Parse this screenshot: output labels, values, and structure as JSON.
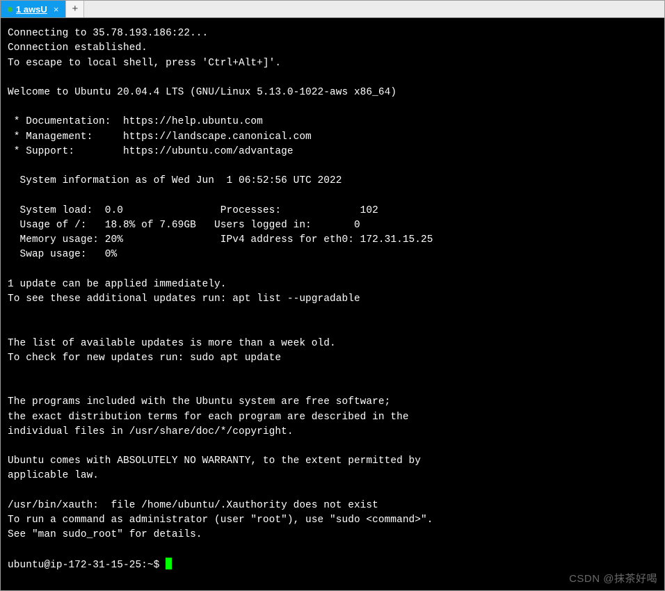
{
  "tabs": {
    "active_label": "1 awsU",
    "close_glyph": "×",
    "new_tab_glyph": "+"
  },
  "terminal": {
    "connecting": "Connecting to 35.78.193.186:22...",
    "established": "Connection established.",
    "escape_hint": "To escape to local shell, press 'Ctrl+Alt+]'.",
    "welcome": "Welcome to Ubuntu 20.04.4 LTS (GNU/Linux 5.13.0-1022-aws x86_64)",
    "doc_line": " * Documentation:  https://help.ubuntu.com",
    "mgmt_line": " * Management:     https://landscape.canonical.com",
    "support_line": " * Support:        https://ubuntu.com/advantage",
    "sysinfo_header": "  System information as of Wed Jun  1 06:52:56 UTC 2022",
    "row1": "  System load:  0.0                Processes:             102",
    "row2": "  Usage of /:   18.8% of 7.69GB   Users logged in:       0",
    "row3": "  Memory usage: 20%                IPv4 address for eth0: 172.31.15.25",
    "row4": "  Swap usage:   0%",
    "updates1": "1 update can be applied immediately.",
    "updates2": "To see these additional updates run: apt list --upgradable",
    "listold1": "The list of available updates is more than a week old.",
    "listold2": "To check for new updates run: sudo apt update",
    "programs1": "The programs included with the Ubuntu system are free software;",
    "programs2": "the exact distribution terms for each program are described in the",
    "programs3": "individual files in /usr/share/doc/*/copyright.",
    "warranty1": "Ubuntu comes with ABSOLUTELY NO WARRANTY, to the extent permitted by",
    "warranty2": "applicable law.",
    "xauth": "/usr/bin/xauth:  file /home/ubuntu/.Xauthority does not exist",
    "sudo1": "To run a command as administrator (user \"root\"), use \"sudo <command>\".",
    "sudo2": "See \"man sudo_root\" for details.",
    "prompt": "ubuntu@ip-172-31-15-25:~$ "
  },
  "watermark": "CSDN @抹茶好喝"
}
